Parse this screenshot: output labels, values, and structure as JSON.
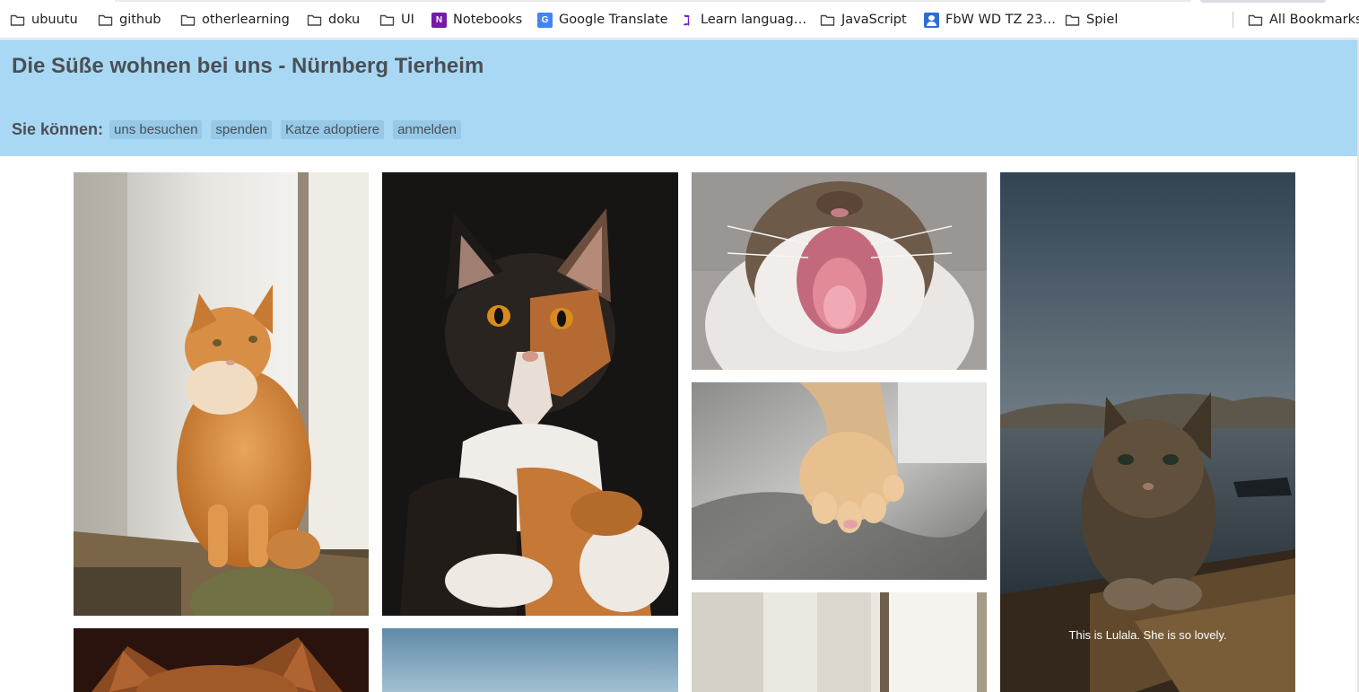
{
  "bookmarks": [
    {
      "label": "ubuutu",
      "icon": "folder-icon"
    },
    {
      "label": "github",
      "icon": "folder-icon"
    },
    {
      "label": "otherlearning",
      "icon": "folder-icon"
    },
    {
      "label": "doku",
      "icon": "folder-icon"
    },
    {
      "label": "UI",
      "icon": "folder-icon"
    },
    {
      "label": "Notebooks",
      "icon": "onenote-icon"
    },
    {
      "label": "Google Translate",
      "icon": "google-translate-icon"
    },
    {
      "label": "Learn languag…",
      "icon": "learn-languages-icon"
    },
    {
      "label": "JavaScript",
      "icon": "folder-icon"
    },
    {
      "label": "FbW WD TZ 23…",
      "icon": "profile-icon"
    },
    {
      "label": "Spiel",
      "icon": "folder-icon"
    },
    {
      "label": "All Bookmarks",
      "icon": "folder-icon"
    }
  ],
  "header": {
    "title": "Die Süße wohnen bei uns - Nürnberg Tierheim",
    "nav_label": "Sie können:",
    "links": [
      "uns besuchen",
      "spenden",
      "Katze adoptiere",
      "anmelden"
    ]
  },
  "gallery": {
    "caption": "This is Lulala. She is so lovely."
  },
  "colors": {
    "header_bg": "#a9d8f4",
    "link_bg": "#96c9e8",
    "text": "#4b4f54"
  }
}
